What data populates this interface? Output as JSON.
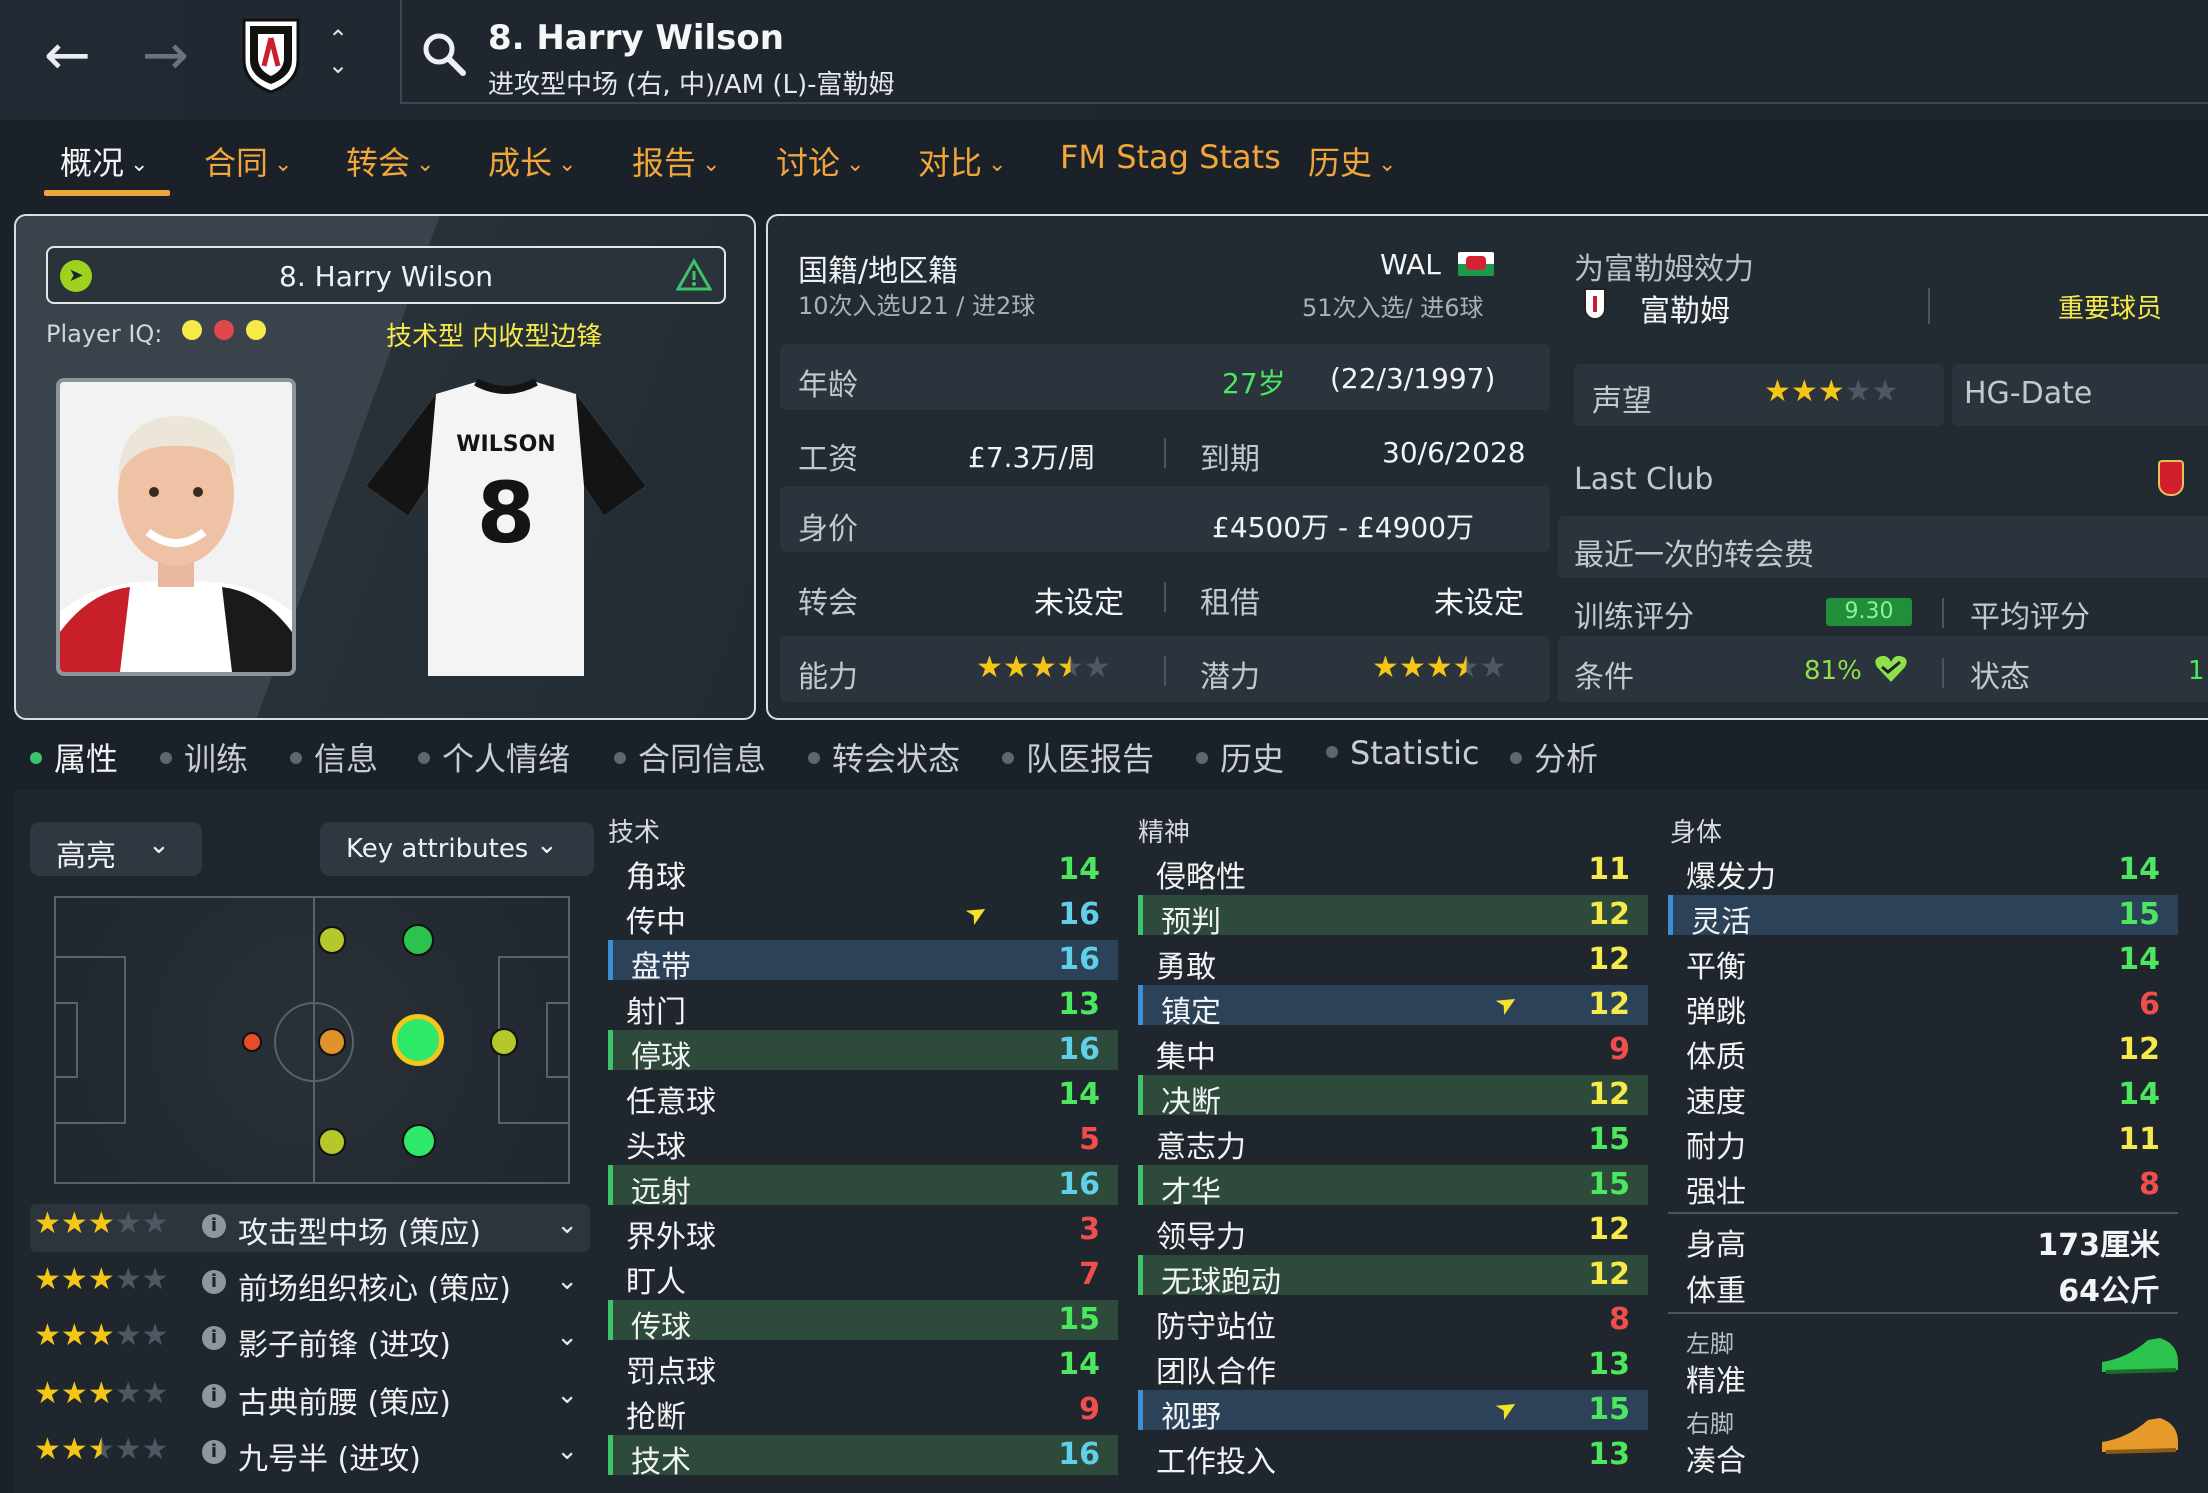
{
  "header": {
    "player_title": "8. Harry Wilson",
    "player_subtitle": "进攻型中场 (右, 中)/AM (L)-富勒姆"
  },
  "menu": [
    {
      "label": "概况",
      "active": true
    },
    {
      "label": "合同"
    },
    {
      "label": "转会"
    },
    {
      "label": "成长"
    },
    {
      "label": "报告"
    },
    {
      "label": "讨论"
    },
    {
      "label": "对比"
    },
    {
      "label": "FM Stag Stats"
    },
    {
      "label": "历史"
    }
  ],
  "profile": {
    "name": "8. Harry Wilson",
    "player_iq_label": "Player IQ:",
    "personality_tags": "技术型 内收型边锋",
    "shirt_name": "WILSON",
    "shirt_number": "8"
  },
  "info": {
    "nationality_label": "国籍/地区籍",
    "nationality_value": "WAL",
    "u21_caps": "10次入选U21 / 进2球",
    "senior_caps": "51次入选/ 进6球",
    "age_label": "年龄",
    "age_value": "27岁",
    "dob": "(22/3/1997)",
    "wage_label": "工资",
    "wage_value": "£7.3万/周",
    "expiry_label": "到期",
    "expiry_value": "30/6/2028",
    "value_label": "身价",
    "value_value": "£4500万 - £4900万",
    "transfer_label": "转会",
    "transfer_value": "未设定",
    "loan_label": "租借",
    "loan_value": "未设定",
    "ability_label": "能力",
    "ability_stars": 3.5,
    "potential_label": "潜力",
    "potential_stars": 3.5
  },
  "club": {
    "plays_for_label": "为富勒姆效力",
    "club_name": "富勒姆",
    "squad_status": "重要球员",
    "reputation_label": "声望",
    "reputation_stars": 3,
    "hg_date_label": "HG-Date",
    "last_club_label": "Last Club",
    "last_fee_label": "最近一次的转会费",
    "training_label": "训练评分",
    "training_value": "9.30",
    "avg_rating_label": "平均评分",
    "condition_label": "条件",
    "condition_value": "81%",
    "form_label": "状态",
    "form_value": "1"
  },
  "subtabs": [
    "属性",
    "训练",
    "信息",
    "个人情绪",
    "合同信息",
    "转会状态",
    "队医报告",
    "历史",
    "Statistic",
    "分析"
  ],
  "controls": {
    "highlight_dropdown": "高亮",
    "key_attributes_dropdown": "Key attributes"
  },
  "roles": [
    {
      "stars": 3,
      "label": "攻击型中场 (策应)"
    },
    {
      "stars": 3,
      "label": "前场组织核心 (策应)"
    },
    {
      "stars": 3,
      "label": "影子前锋 (进攻)"
    },
    {
      "stars": 3,
      "label": "古典前腰 (策应)"
    },
    {
      "stars": 2.5,
      "label": "九号半 (进攻)"
    }
  ],
  "attributes": {
    "technical_title": "技术",
    "technical": [
      {
        "name": "角球",
        "value": "14",
        "color": "green"
      },
      {
        "name": "传中",
        "value": "16",
        "color": "cyan",
        "spark": true
      },
      {
        "name": "盘带",
        "value": "16",
        "color": "cyan",
        "hl": "blue"
      },
      {
        "name": "射门",
        "value": "13",
        "color": "green"
      },
      {
        "name": "停球",
        "value": "16",
        "color": "cyan",
        "hl": "green"
      },
      {
        "name": "任意球",
        "value": "14",
        "color": "green"
      },
      {
        "name": "头球",
        "value": "5",
        "color": "red"
      },
      {
        "name": "远射",
        "value": "16",
        "color": "cyan",
        "hl": "green"
      },
      {
        "name": "界外球",
        "value": "3",
        "color": "red"
      },
      {
        "name": "盯人",
        "value": "7",
        "color": "red"
      },
      {
        "name": "传球",
        "value": "15",
        "color": "green",
        "hl": "green"
      },
      {
        "name": "罚点球",
        "value": "14",
        "color": "green"
      },
      {
        "name": "抢断",
        "value": "9",
        "color": "red"
      },
      {
        "name": "技术",
        "value": "16",
        "color": "cyan",
        "hl": "green"
      }
    ],
    "mental_title": "精神",
    "mental": [
      {
        "name": "侵略性",
        "value": "11",
        "color": "yellow"
      },
      {
        "name": "预判",
        "value": "12",
        "color": "yellow",
        "hl": "green"
      },
      {
        "name": "勇敢",
        "value": "12",
        "color": "yellow"
      },
      {
        "name": "镇定",
        "value": "12",
        "color": "yellow",
        "hl": "blue",
        "spark": true
      },
      {
        "name": "集中",
        "value": "9",
        "color": "red"
      },
      {
        "name": "决断",
        "value": "12",
        "color": "yellow",
        "hl": "green"
      },
      {
        "name": "意志力",
        "value": "15",
        "color": "green"
      },
      {
        "name": "才华",
        "value": "15",
        "color": "green",
        "hl": "green"
      },
      {
        "name": "领导力",
        "value": "12",
        "color": "yellow"
      },
      {
        "name": "无球跑动",
        "value": "12",
        "color": "yellow",
        "hl": "green"
      },
      {
        "name": "防守站位",
        "value": "8",
        "color": "red"
      },
      {
        "name": "团队合作",
        "value": "13",
        "color": "green"
      },
      {
        "name": "视野",
        "value": "15",
        "color": "green",
        "hl": "blue",
        "spark": true
      },
      {
        "name": "工作投入",
        "value": "13",
        "color": "green"
      }
    ],
    "physical_title": "身体",
    "physical": [
      {
        "name": "爆发力",
        "value": "14",
        "color": "green"
      },
      {
        "name": "灵活",
        "value": "15",
        "color": "green",
        "hl": "blue"
      },
      {
        "name": "平衡",
        "value": "14",
        "color": "green"
      },
      {
        "name": "弹跳",
        "value": "6",
        "color": "red"
      },
      {
        "name": "体质",
        "value": "12",
        "color": "yellow"
      },
      {
        "name": "速度",
        "value": "14",
        "color": "green"
      },
      {
        "name": "耐力",
        "value": "11",
        "color": "yellow"
      },
      {
        "name": "强壮",
        "value": "8",
        "color": "red"
      }
    ],
    "height_label": "身高",
    "height_value": "173厘米",
    "weight_label": "体重",
    "weight_value": "64公斤",
    "left_foot_label": "左脚",
    "left_foot_value": "精准",
    "right_foot_label": "右脚",
    "right_foot_value": "凑合"
  },
  "colors": {
    "accent_orange": "#f0a63a",
    "attr_green": "#4ce65f",
    "attr_cyan": "#5fd0e8",
    "attr_yellow": "#f6e94a",
    "attr_red": "#f04d4d",
    "star": "#f5c518"
  }
}
